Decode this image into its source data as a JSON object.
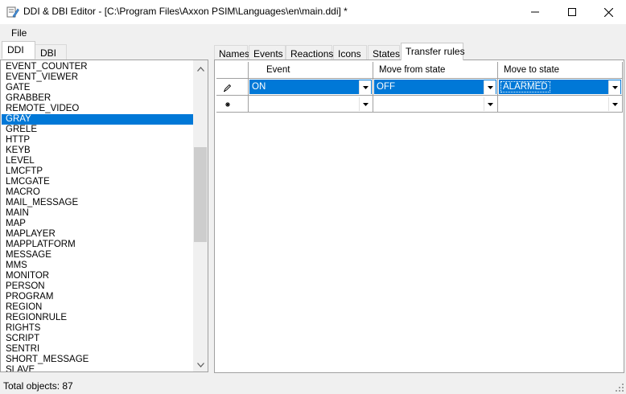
{
  "window": {
    "title": "DDI & DBI Editor - [C:\\Program Files\\Axxon PSIM\\Languages\\en\\main.ddi] *",
    "controls": [
      "minimize-icon",
      "maximize-icon",
      "close-icon"
    ]
  },
  "menu": {
    "file": "File"
  },
  "left_tabs": {
    "ddi": "DDI",
    "dbi": "DBI",
    "active": "DDI"
  },
  "objects": {
    "items": [
      "EVENT_COUNTER",
      "EVENT_VIEWER",
      "GATE",
      "GRABBER",
      "REMOTE_VIDEO",
      "GRAY",
      "GRELE",
      "HTTP",
      "KEYB",
      "LEVEL",
      "LMCFTP",
      "LMCGATE",
      "MACRO",
      "MAIL_MESSAGE",
      "MAIN",
      "MAP",
      "MAPLAYER",
      "MAPPLATFORM",
      "MESSAGE",
      "MMS",
      "MONITOR",
      "PERSON",
      "PROGRAM",
      "REGION",
      "REGIONRULE",
      "RIGHTS",
      "SCRIPT",
      "SENTRI",
      "SHORT_MESSAGE",
      "SLAVE"
    ],
    "selected": "GRAY"
  },
  "right_tabs": {
    "names": "Names",
    "events": "Events",
    "reactions": "Reactions",
    "icons": "Icons",
    "states": "States",
    "transfer_rules": "Transfer rules",
    "active": "Transfer rules"
  },
  "grid": {
    "columns": [
      "Event",
      "Move from state",
      "Move to state"
    ],
    "rows": [
      {
        "indicator": "pencil-icon",
        "event": "ON",
        "from": "OFF",
        "to": "ALARMED",
        "selected": true
      },
      {
        "indicator": "new-row-icon",
        "event": "",
        "from": "",
        "to": "",
        "selected": false
      }
    ]
  },
  "status": {
    "text": "Total objects: 87"
  },
  "colors": {
    "selection": "#0078d7",
    "window_bg": "#f0f0f0",
    "border": "#a0a0a0"
  }
}
